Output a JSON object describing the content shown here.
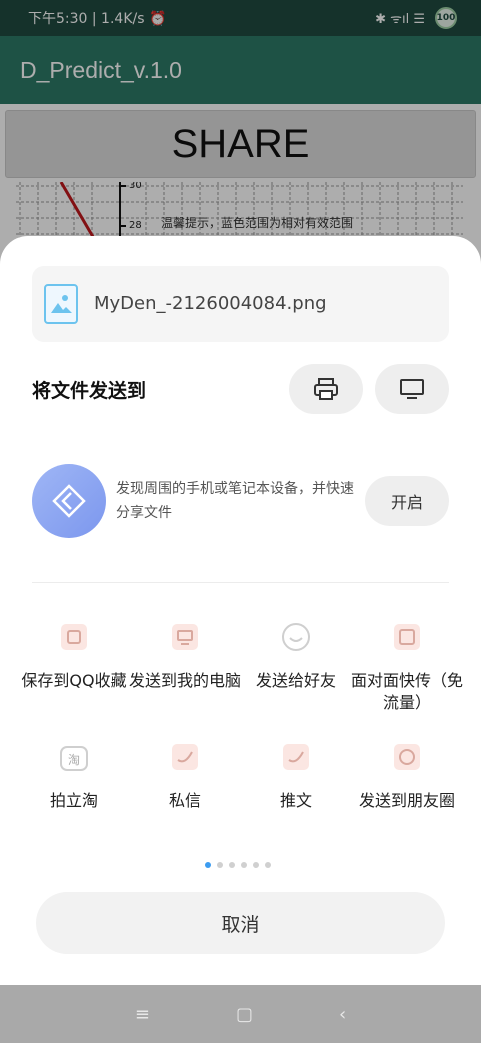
{
  "status_bar": {
    "time": "下午5:30 | 1.4K/s ⏰",
    "signal": "✱ ᯤıl ☰",
    "battery": "100"
  },
  "app": {
    "title": "D_Predict_v.1.0",
    "share_button": "SHARE",
    "chart": {
      "tick_top": "30",
      "tick_mid": "28",
      "tip": "温馨提示，蓝色范围为相对有效范围"
    }
  },
  "sheet": {
    "file_name": "MyDen_-2126004084.png",
    "send_to_label": "将文件发送到",
    "nearby_text": "发现周围的手机或笔记本设备，并快速分享文件",
    "enable_label": "开启",
    "apps": [
      {
        "label": "保存到QQ收藏",
        "icon": "qq-favorites-icon"
      },
      {
        "label": "发送到我的电脑",
        "icon": "my-computer-icon"
      },
      {
        "label": "发送给好友",
        "icon": "friend-icon"
      },
      {
        "label": "面对面快传（免流量）",
        "icon": "face-to-face-icon"
      },
      {
        "label": "拍立淘",
        "icon": "taobao-icon"
      },
      {
        "label": "私信",
        "icon": "twitter-dm-icon"
      },
      {
        "label": "推文",
        "icon": "twitter-icon"
      },
      {
        "label": "发送到朋友圈",
        "icon": "moments-icon"
      }
    ],
    "page_count": 6,
    "active_page": 1,
    "cancel_label": "取消"
  },
  "nav": {
    "menu": "≡",
    "home": "▢",
    "back": "‹"
  }
}
